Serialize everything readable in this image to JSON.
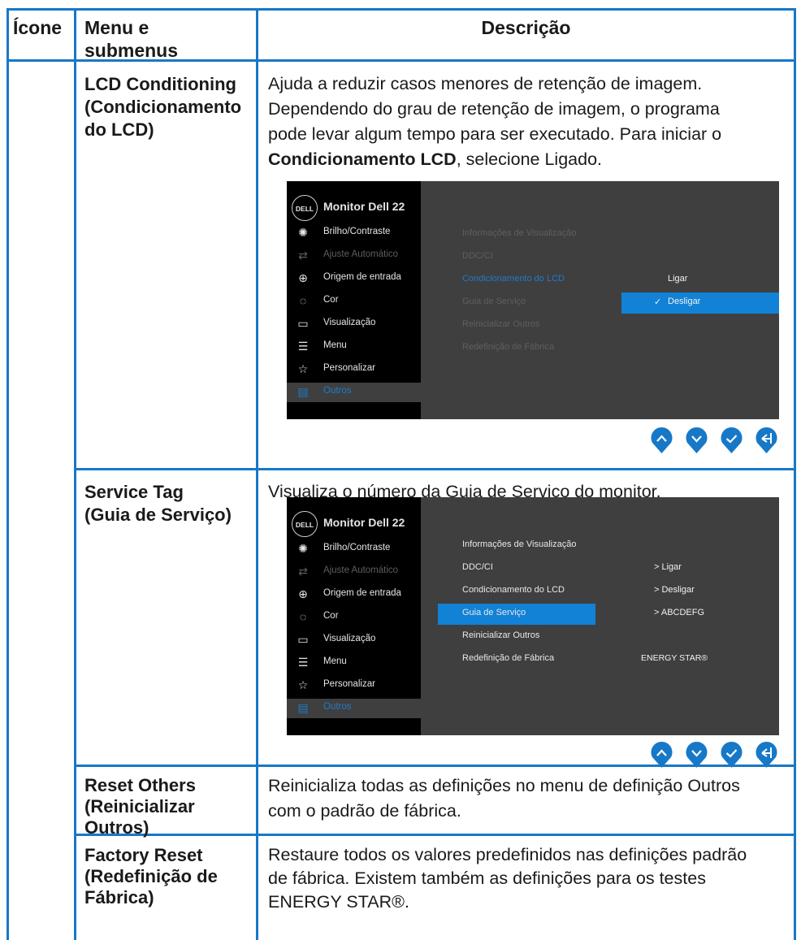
{
  "header": {
    "col_icon": "Ícone",
    "col_menu_line1": "Menu e",
    "col_menu_line2": "submenus",
    "col_desc": "Descrição"
  },
  "rows": [
    {
      "name_lines": [
        "LCD Conditioning",
        "(Condicionamento",
        "do LCD)"
      ],
      "desc_lines": [
        "Ajuda a reduzir casos menores de retenção de imagem.",
        "Dependendo do grau de retenção de imagem, o programa",
        "pode levar algum tempo para ser executado. Para iniciar o"
      ],
      "desc_bold": "Condicionamento LCD",
      "desc_tail": ", selecione Ligado."
    },
    {
      "name_lines": [
        "Service Tag",
        "(Guia de Serviço)"
      ],
      "desc_lines": [
        "Visualiza o número da Guia de Serviço do monitor."
      ]
    },
    {
      "name_lines": [
        "Reset Others",
        "(Reinicializar",
        "Outros)"
      ],
      "desc_lines": [
        "Reinicializa todas as definições no menu de definição Outros",
        "com o padrão de fábrica."
      ]
    },
    {
      "name_lines": [
        "Factory Reset",
        "(Redefinição de",
        "Fábrica)"
      ],
      "desc_lines": [
        "Restaure todos os valores predefinidos nas definições padrão",
        "de fábrica. Existem também as definições para os testes",
        "ENERGY STAR®."
      ]
    }
  ],
  "osd": {
    "logo": "DELL",
    "model": "Monitor Dell 22",
    "menu": [
      {
        "label": "Brilho/Contraste",
        "icon": "brightness-icon"
      },
      {
        "label": "Ajuste Automático",
        "icon": "auto-adjust-icon"
      },
      {
        "label": "Origem de entrada",
        "icon": "input-source-icon"
      },
      {
        "label": "Cor",
        "icon": "color-icon"
      },
      {
        "label": "Visualização",
        "icon": "display-icon"
      },
      {
        "label": "Menu",
        "icon": "menu-icon"
      },
      {
        "label": "Personalizar",
        "icon": "star-icon"
      },
      {
        "label": "Outros",
        "icon": "others-icon"
      }
    ],
    "submenu": [
      "Informações de Visualização",
      "DDC/CI",
      "Condicionamento do LCD",
      "Guia de Serviço",
      "Reinicializar Outros",
      "Redefinição de Fábrica"
    ],
    "panel1_options": [
      "Ligar",
      "Desligar"
    ],
    "panel1_check": "✓",
    "panel2_values": [
      "> Ligar",
      "> Desligar",
      "> ABCDEFG"
    ],
    "panel2_energy": "ENERGY STAR®",
    "nav_buttons": [
      "up-button",
      "down-button",
      "ok-button",
      "back-button"
    ]
  },
  "colors": {
    "border": "#1778c8",
    "accent": "#1182d6",
    "osd_bg": "#3f3f3f",
    "osd_side": "#000000"
  }
}
